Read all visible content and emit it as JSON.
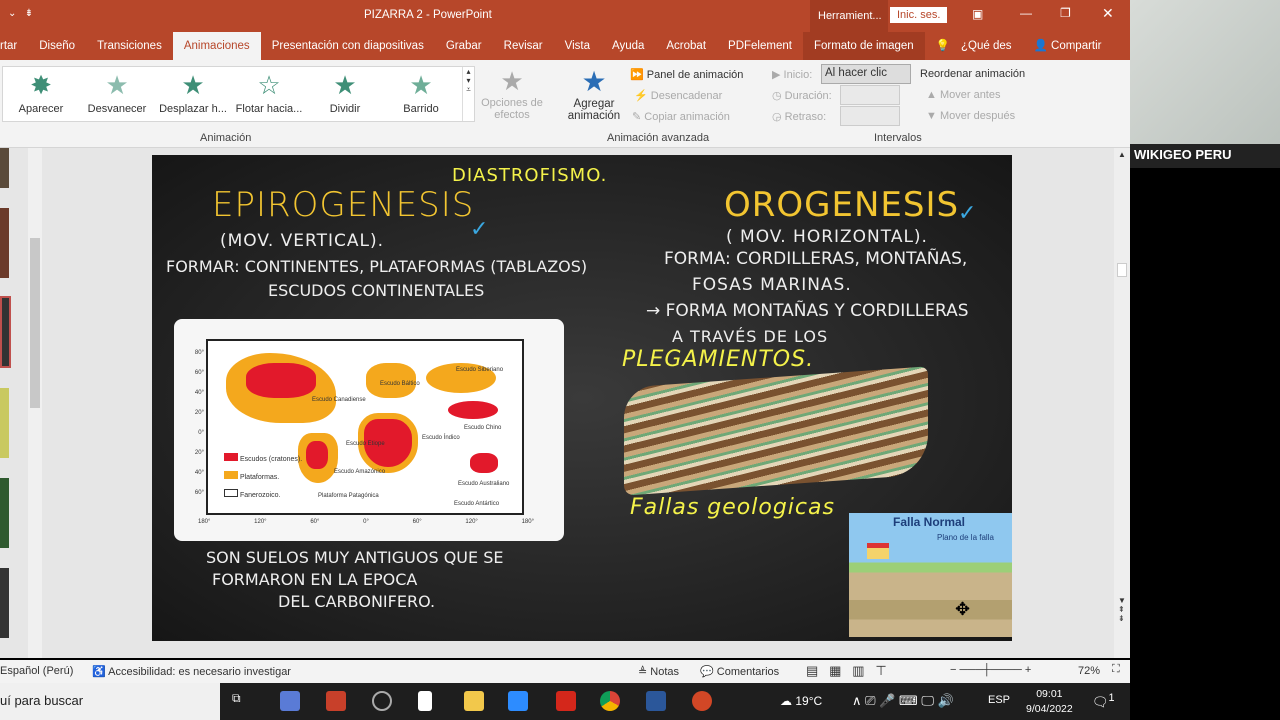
{
  "window": {
    "title": "PIZARRA 2  -  PowerPoint",
    "tools_label": "Herramient...",
    "signin": "Inic. ses."
  },
  "tabs": [
    "rtar",
    "Diseño",
    "Transiciones",
    "Animaciones",
    "Presentación con diapositivas",
    "Grabar",
    "Revisar",
    "Vista",
    "Ayuda",
    "Acrobat",
    "PDFelement",
    "Formato de imagen"
  ],
  "tell_me": "¿Qué des",
  "share": "Compartir",
  "effects": [
    "Aparecer",
    "Desvanecer",
    "Desplazar h...",
    "Flotar hacia...",
    "Dividir",
    "Barrido"
  ],
  "ribbon": {
    "effect_options": "Opciones de efectos",
    "add_animation": "Agregar animación",
    "panel": "Panel de animación",
    "trigger": "Desencadenar",
    "copy": "Copiar animación",
    "start_label": "Inicio:",
    "start_value": "Al hacer clic",
    "duration": "Duración:",
    "delay": "Retraso:",
    "reorder": "Reordenar animación",
    "move_earlier": "Mover antes",
    "move_later": "Mover después",
    "group_animation": "Animación",
    "group_advanced": "Animación avanzada",
    "group_timing": "Intervalos"
  },
  "slide": {
    "diastrofismo": "DIASTROFISMO.",
    "epiro": "EPIROGENESIS",
    "epiro_sub": "(MOV. VERTICAL).",
    "epiro_forma": "FORMAR: CONTINENTES, PLATAFORMAS (TABLAZOS)",
    "epiro_escudos": "ESCUDOS CONTINENTALES",
    "oro": "OROGENESIS",
    "oro_sub": "( MOV. HORIZONTAL).",
    "oro_forma": "FORMA: CORDILLERAS, MONTAÑAS,",
    "oro_fosas": "FOSAS MARINAS.",
    "oro_arrow": "→ FORMA MONTAÑAS Y CORDILLERAS",
    "oro_traves": "A TRAVÉS DE LOS",
    "plegamientos": "PLEGAMIENTOS.",
    "fallas": "Fallas geologicas",
    "suelos": [
      "SON SUELOS MUY ANTIGUOS QUE SE",
      "FORMARON EN LA EPOCA",
      "DEL CARBONIFERO."
    ],
    "map": {
      "legend": [
        "Escudos (cratones).",
        "Plataformas.",
        "Fanerozoico."
      ],
      "labels": [
        "Escudo Canadiense",
        "Escudo Báltico",
        "Escudo Siberiano",
        "Escudo Chino",
        "Escudo Índico",
        "Escudo Etiope",
        "Escudo Amazónico",
        "Plataforma Patagónica",
        "Escudo Australiano",
        "Escudo Antártico"
      ],
      "lat": [
        "80°",
        "60°",
        "40°",
        "20°",
        "0°",
        "20°",
        "40°",
        "60°"
      ],
      "lon": [
        "180°",
        "120°",
        "60°",
        "0°",
        "60°",
        "120°",
        "180°"
      ],
      "colors": {
        "shield": "#e2192b",
        "platform": "#f4a81d"
      }
    },
    "falla": {
      "title": "Falla Normal",
      "plano": "Plano de la falla"
    }
  },
  "status": {
    "lang": "Español (Perú)",
    "access": "Accesibilidad: es necesario investigar",
    "notes": "Notas",
    "comments": "Comentarios",
    "zoom": "72%"
  },
  "taskbar": {
    "search": "uí para buscar",
    "temp": "19°C",
    "lang": "ESP",
    "time": "09:01",
    "date": "9/04/2022",
    "notif": "1"
  },
  "webcam": {
    "label": "WIKIGEO PERU"
  }
}
